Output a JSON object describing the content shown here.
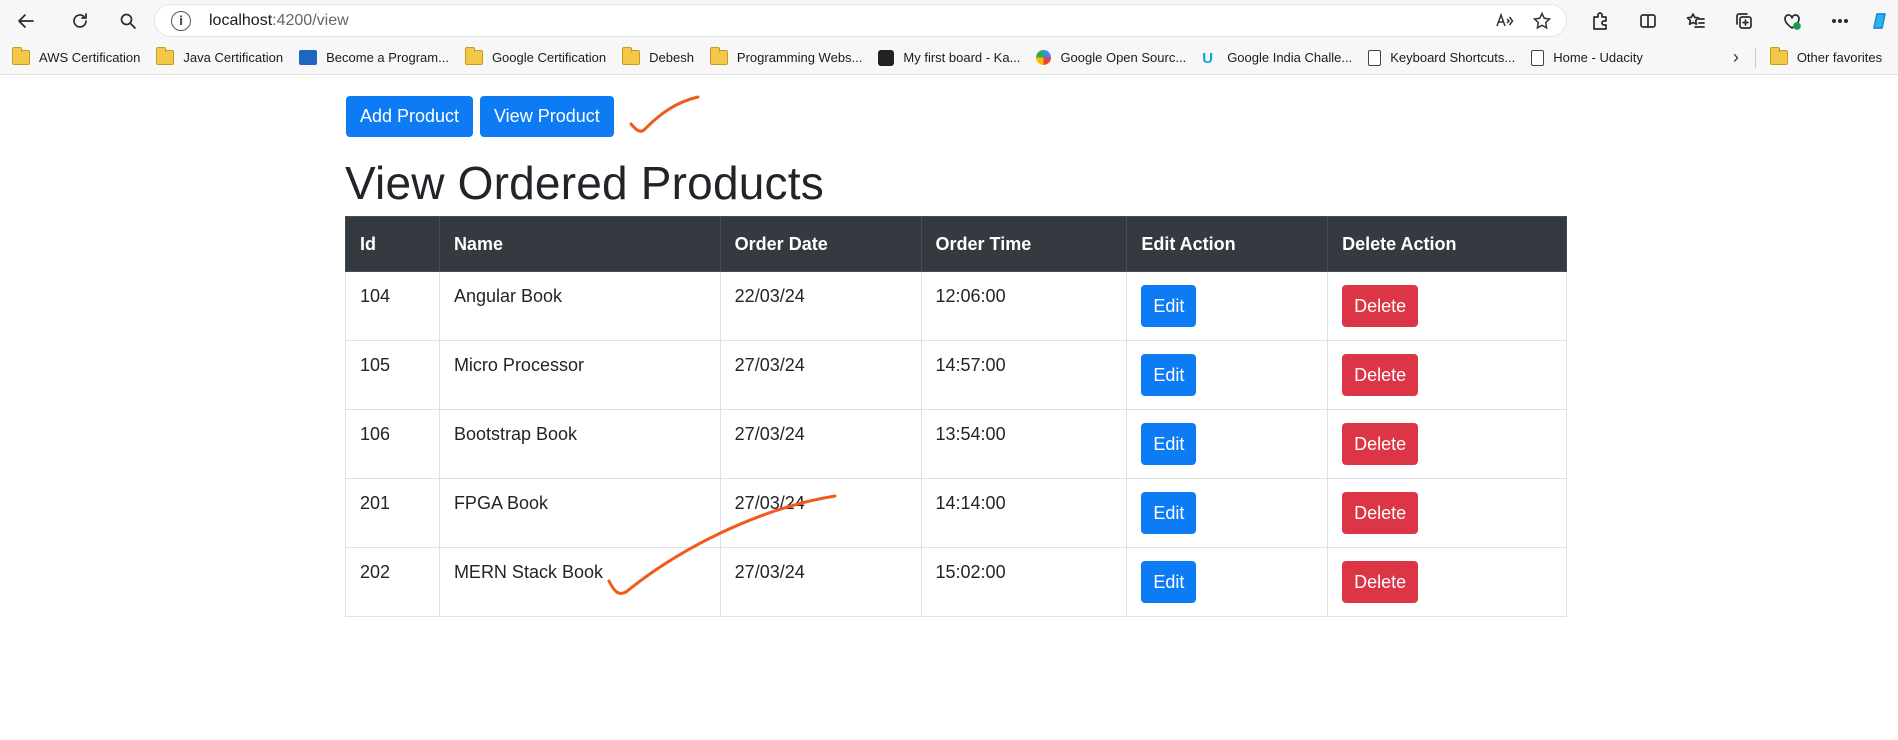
{
  "browser": {
    "url_host": "localhost",
    "url_path": ":4200/view",
    "bookmarks": [
      {
        "label": "AWS Certification",
        "icon": "folder-icon"
      },
      {
        "label": "Java Certification",
        "icon": "folder-icon"
      },
      {
        "label": "Become a Program...",
        "icon": "video-icon"
      },
      {
        "label": "Google Certification",
        "icon": "folder-icon"
      },
      {
        "label": "Debesh",
        "icon": "folder-icon"
      },
      {
        "label": "Programming Webs...",
        "icon": "folder-icon"
      },
      {
        "label": "My first board - Ka...",
        "icon": "kanban-icon"
      },
      {
        "label": "Google Open Sourc...",
        "icon": "google-icon"
      },
      {
        "label": "Google India Challe...",
        "icon": "udacity-icon"
      },
      {
        "label": "Keyboard Shortcuts...",
        "icon": "page-icon"
      },
      {
        "label": "Home - Udacity",
        "icon": "page-icon"
      }
    ],
    "other_favorites": "Other favorites"
  },
  "nav": {
    "add_label": "Add Product",
    "view_label": "View Product"
  },
  "page": {
    "title": "View Ordered Products"
  },
  "table": {
    "headers": [
      "Id",
      "Name",
      "Order Date",
      "Order Time",
      "Edit Action",
      "Delete Action"
    ],
    "rows": [
      {
        "id": "104",
        "name": "Angular Book",
        "date": "22/03/24",
        "time": "12:06:00"
      },
      {
        "id": "105",
        "name": "Micro Processor",
        "date": "27/03/24",
        "time": "14:57:00"
      },
      {
        "id": "106",
        "name": "Bootstrap Book",
        "date": "27/03/24",
        "time": "13:54:00"
      },
      {
        "id": "201",
        "name": "FPGA Book",
        "date": "27/03/24",
        "time": "14:14:00"
      },
      {
        "id": "202",
        "name": "MERN Stack Book",
        "date": "27/03/24",
        "time": "15:02:00"
      }
    ],
    "edit_label": "Edit",
    "delete_label": "Delete"
  },
  "colors": {
    "primary": "#0d7cf4",
    "danger": "#dc3545",
    "header_bg": "#343a40",
    "annotation": "#f25a1a"
  }
}
